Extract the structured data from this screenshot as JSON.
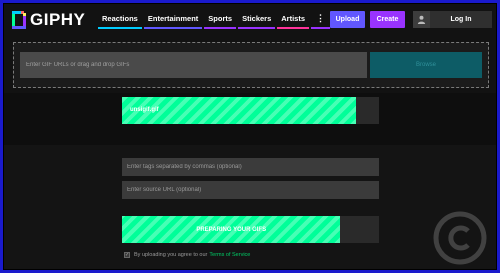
{
  "brand": {
    "name": "GIPHY"
  },
  "nav": {
    "items": [
      {
        "label": "Reactions",
        "color": "#00ccff"
      },
      {
        "label": "Entertainment",
        "color": "#6157ff"
      },
      {
        "label": "Sports",
        "color": "#9933ff"
      },
      {
        "label": "Stickers",
        "color": "#9933ff"
      },
      {
        "label": "Artists",
        "color": "#ff3399"
      }
    ],
    "more_label": "⋮"
  },
  "header": {
    "upload_label": "Upload",
    "create_label": "Create",
    "login_label": "Log In"
  },
  "dropzone": {
    "url_placeholder": "Enter GIF URLs or drag and drop GIFs",
    "browse_label": "Browse"
  },
  "upload": {
    "file_name": "unsigif.gif",
    "file_progress": 0.91,
    "tags_placeholder": "Enter tags separated by commas (optional)",
    "source_placeholder": "Enter source URL (optional)",
    "preparing_label": "PREPARING YOUR GIFS",
    "preparing_progress": 0.85,
    "terms_text": "By uploading you agree to our",
    "terms_link": "Terms of Service"
  },
  "colors": {
    "accent_green": "#00ff99",
    "upload_purple": "#6157ff",
    "create_purple": "#9933ff",
    "outer_border": "#1a1acc"
  },
  "icons": {
    "logo": "giphy-logo-icon",
    "user": "user-icon",
    "watermark": "copyright-icon"
  }
}
